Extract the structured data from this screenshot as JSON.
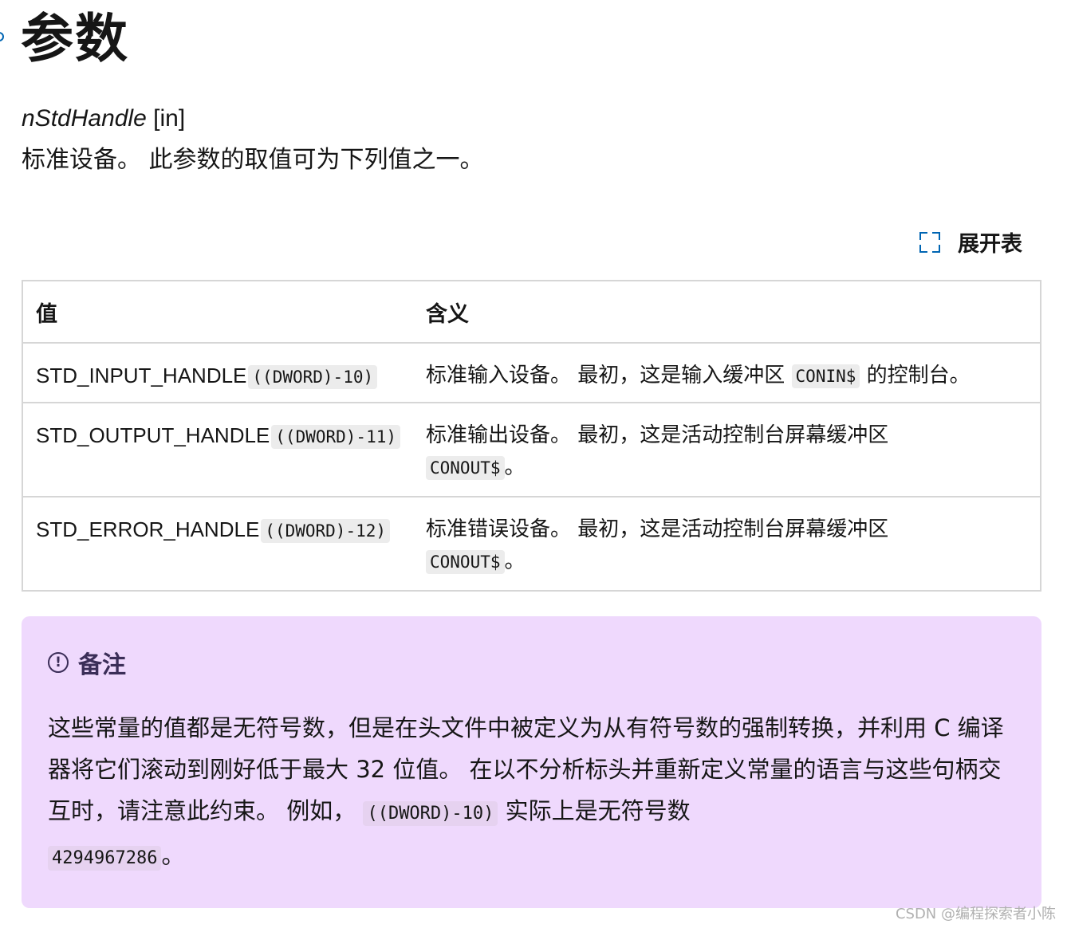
{
  "section_title": "参数",
  "param": {
    "name": "nStdHandle",
    "direction": "[in]",
    "description": "标准设备。 此参数的取值可为下列值之一。"
  },
  "expand_table_label": "展开表",
  "table": {
    "headers": [
      "值",
      "含义"
    ],
    "rows": [
      {
        "value": "STD_INPUT_HANDLE",
        "code": "((DWORD)-10)",
        "meaning_text": "标准输入设备。 最初，这是输入缓冲区",
        "meaning_code": "CONIN$",
        "meaning_suffix": "的控制台。"
      },
      {
        "value": "STD_OUTPUT_HANDLE",
        "code": "((DWORD)-11)",
        "meaning_text": "标准输出设备。 最初，这是活动控制台屏幕缓冲区",
        "meaning_code": "CONOUT$",
        "meaning_suffix": "。"
      },
      {
        "value": "STD_ERROR_HANDLE",
        "code": "((DWORD)-12)",
        "meaning_text": "标准错误设备。 最初，这是活动控制台屏幕缓冲区",
        "meaning_code": "CONOUT$",
        "meaning_suffix": "。"
      }
    ]
  },
  "note": {
    "title": "备注",
    "icon": "info-circle-icon",
    "text_part1": "这些常量的值都是无符号数，但是在头文件中被定义为从有符号数的强制转换，并利用 C 编译器将它们滚动到刚好低于最大 32 位值。 在以不分析标头并重新定义常量的语言与这些句柄交互时，请注意此约束。 例如，",
    "code1": "((DWORD)-10)",
    "text_part2": "实际上是无符号数",
    "code2": "4294967286",
    "text_part3": "。"
  },
  "watermark": "CSDN @编程探索者小陈",
  "colors": {
    "accent": "#0065b3",
    "note_background": "#efd9fd",
    "note_heading": "#3b2e58",
    "code_background": "#ececec"
  }
}
